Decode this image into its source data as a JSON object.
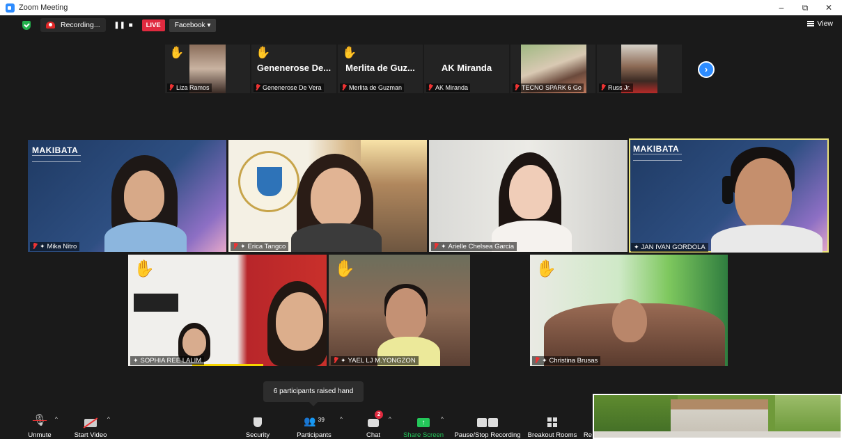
{
  "window": {
    "title": "Zoom Meeting",
    "minimize_glyph": "–",
    "restore_glyph": "⧉",
    "close_glyph": "✕"
  },
  "status_bar": {
    "recording_label": "Recording...",
    "live_label": "LIVE",
    "stream_target": "Facebook",
    "view_label": "View"
  },
  "thumbnails": [
    {
      "name": "Liza Ramos",
      "hand_raised": true,
      "has_video": true
    },
    {
      "name": "Genenerose De Vera",
      "display_title": "Genenerose De...",
      "hand_raised": true,
      "has_video": false
    },
    {
      "name": "Merlita de Guzman",
      "display_title": "Merlita de Guz...",
      "hand_raised": true,
      "has_video": false
    },
    {
      "name": "AK Miranda",
      "display_title": "AK Miranda",
      "hand_raised": false,
      "has_video": false
    },
    {
      "name": "TECNO SPARK 6 Go",
      "hand_raised": false,
      "has_video": true
    },
    {
      "name": "Russ Jr.",
      "hand_raised": false,
      "has_video": true
    }
  ],
  "grid": [
    {
      "name": "Mika Nitro",
      "muted": true,
      "pinned": true,
      "background": "MAKIBATA"
    },
    {
      "name": "Erica Tangco",
      "muted": true,
      "pinned": true
    },
    {
      "name": "Arielle Chelsea Garcia",
      "muted": true,
      "pinned": true
    },
    {
      "name": "JAN IVAN GORDOLA",
      "muted": false,
      "pinned": true,
      "background": "MAKIBATA",
      "active_speaker": true
    },
    {
      "name": "SOPHIA REE LALIM",
      "muted": false,
      "pinned": true,
      "hand_raised": true
    },
    {
      "name": "YAEL LJ M.YONGZON",
      "muted": true,
      "pinned": true,
      "hand_raised": true
    },
    {
      "name": "Christina Brusas",
      "muted": true,
      "pinned": true,
      "hand_raised": true
    }
  ],
  "tooltip": "6 participants raised hand",
  "toolbar": {
    "unmute": "Unmute",
    "start_video": "Start Video",
    "security": "Security",
    "participants": "Participants",
    "participants_count": "39",
    "chat": "Chat",
    "chat_badge": "2",
    "share_screen": "Share Screen",
    "pause_stop_recording": "Pause/Stop Recording",
    "breakout_rooms": "Breakout Rooms",
    "reactions_truncated": "Re"
  },
  "colors": {
    "live_red": "#e02a3f",
    "share_green": "#24c75a",
    "active_speaker_border": "#ece57a",
    "zoom_blue": "#2d8cff"
  }
}
